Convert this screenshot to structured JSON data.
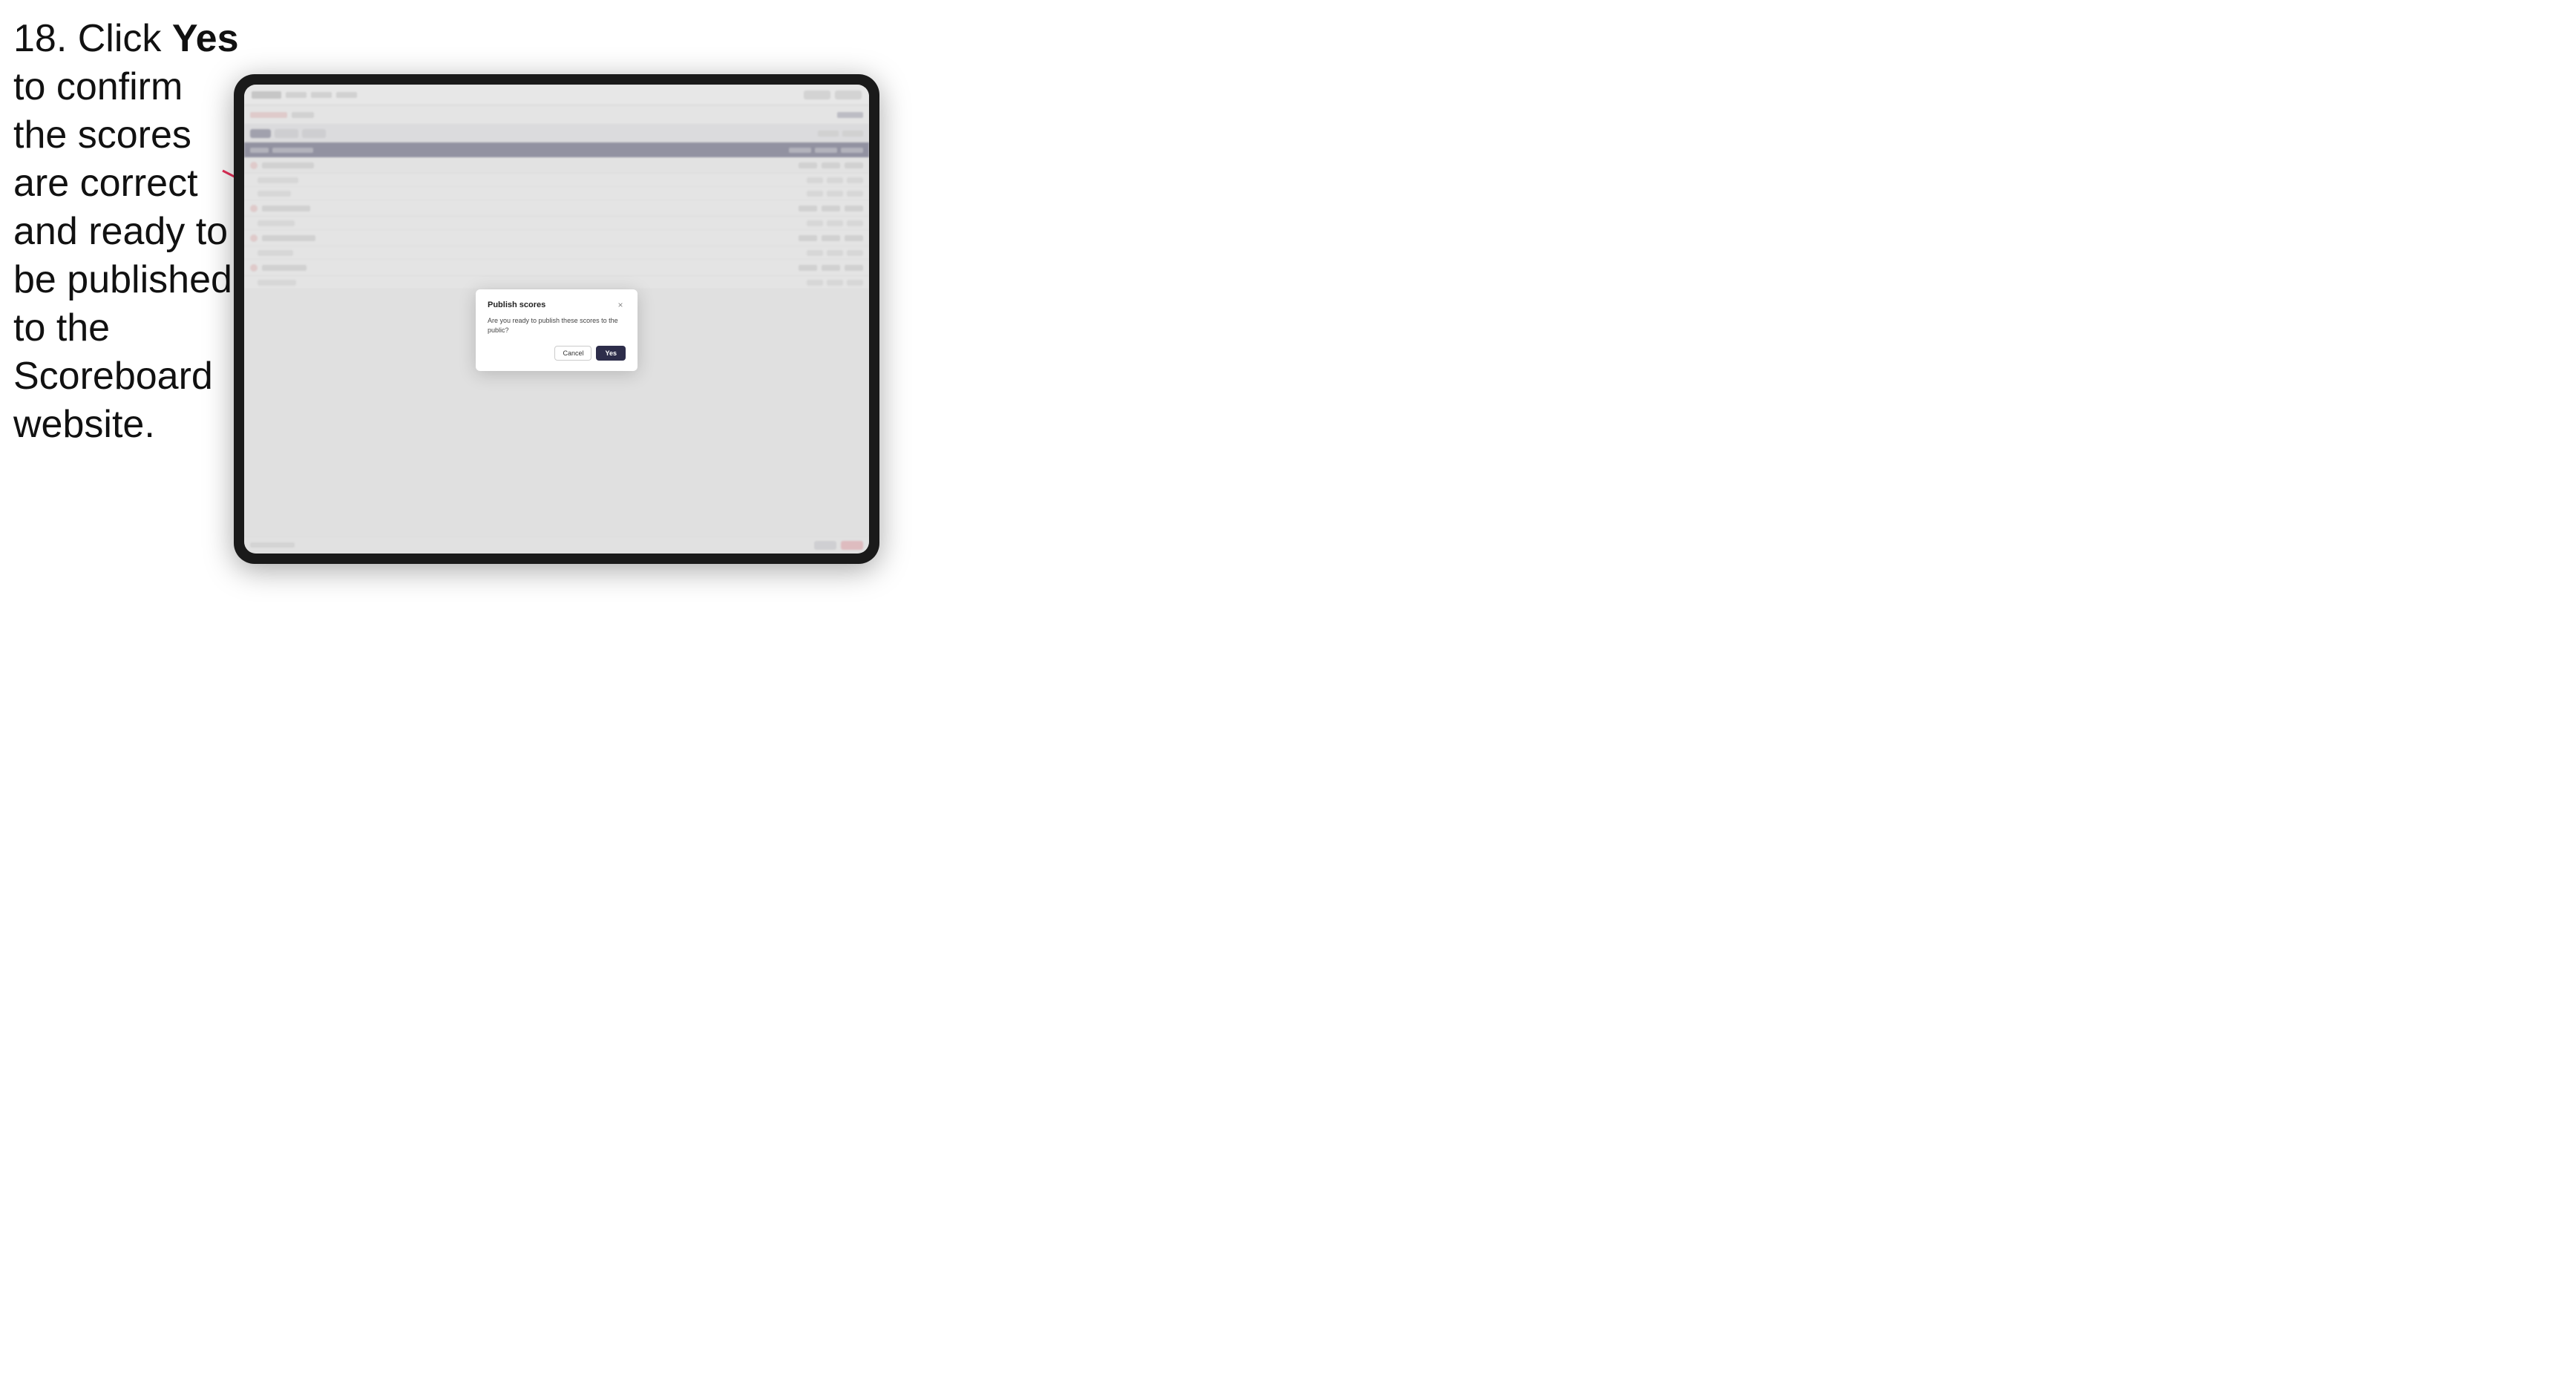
{
  "instruction": {
    "step_number": "18.",
    "text_before_bold": " Click ",
    "bold_text": "Yes",
    "text_after_bold": " to confirm the scores are correct and ready to be published to the Scoreboard website."
  },
  "tablet": {
    "screen": {
      "fake_rows": [
        {
          "cells": [
            40,
            80,
            120,
            60
          ]
        },
        {
          "cells": [
            50,
            90,
            70,
            110
          ]
        },
        {
          "cells": [
            35,
            75,
            95,
            55
          ]
        },
        {
          "cells": [
            45,
            85,
            65,
            100
          ]
        },
        {
          "cells": [
            40,
            70,
            110,
            60
          ]
        },
        {
          "cells": [
            50,
            80,
            75,
            90
          ]
        },
        {
          "cells": [
            35,
            90,
            60,
            105
          ]
        },
        {
          "cells": [
            45,
            75,
            85,
            65
          ]
        }
      ]
    }
  },
  "modal": {
    "title": "Publish scores",
    "body_text": "Are you ready to publish these scores to the public?",
    "cancel_label": "Cancel",
    "yes_label": "Yes",
    "close_icon": "×"
  },
  "arrow": {
    "color": "#e8305a"
  }
}
